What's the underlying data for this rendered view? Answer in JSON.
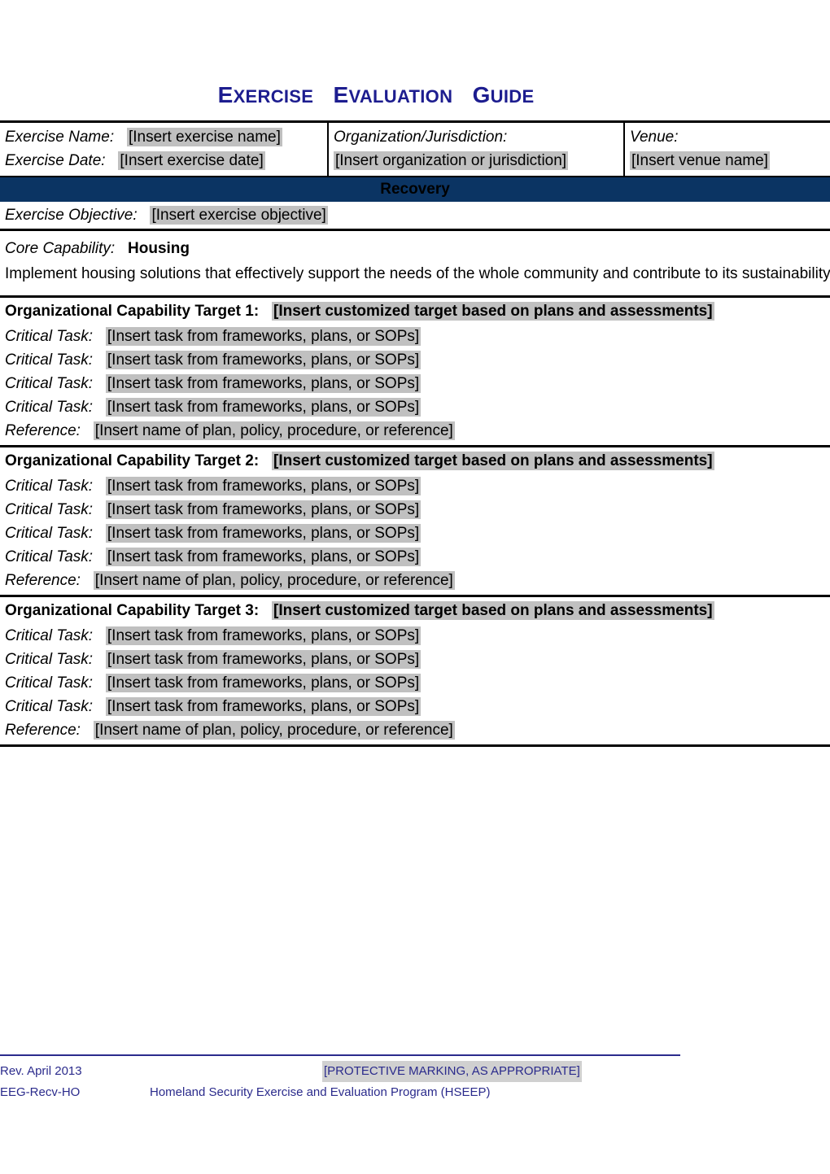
{
  "document": {
    "title_words": [
      {
        "cap": "E",
        "rest": "XERCISE"
      },
      {
        "cap": "E",
        "rest": "VALUATION"
      },
      {
        "cap": "G",
        "rest": "UIDE"
      }
    ],
    "title_plain": "Exercise Evaluation Guide"
  },
  "colors": {
    "title_blue": "#1d1d8f",
    "banner_navy": "#0b3463",
    "footer_blue": "#2b2b8c",
    "highlight_gray": "#c0c0c0"
  },
  "header": {
    "exercise_name_label": "Exercise Name:",
    "exercise_name_value": "[Insert exercise name]",
    "exercise_date_label": "Exercise Date:",
    "exercise_date_value": "[Insert exercise date]",
    "organization_label": "Organization/Jurisdiction:",
    "organization_value": "[Insert organization or jurisdiction]",
    "venue_label": "Venue:",
    "venue_value": "[Insert venue name]"
  },
  "mission_area": {
    "banner_label": "Recovery"
  },
  "objective": {
    "label": "Exercise Objective:",
    "value": "[Insert exercise objective]"
  },
  "capability": {
    "label": "Core Capability:",
    "name": "Housing",
    "description": "Implement housing solutions that effectively support the needs of the whole community and contribute to its sustainability and resilience."
  },
  "targets": [
    {
      "label": "Organizational Capability Target 1:",
      "value": "[Insert customized target based on plans and assessments]",
      "tasks": [
        {
          "label": "Critical Task:",
          "value": "[Insert task from frameworks, plans, or SOPs]"
        },
        {
          "label": "Critical Task:",
          "value": "[Insert task from frameworks, plans, or SOPs]"
        },
        {
          "label": "Critical Task:",
          "value": "[Insert task from frameworks, plans, or SOPs]"
        },
        {
          "label": "Critical Task:",
          "value": "[Insert task from frameworks, plans, or SOPs]"
        }
      ],
      "reference_label": "Reference:",
      "reference_value": "[Insert name of plan, policy, procedure, or reference]"
    },
    {
      "label": "Organizational Capability Target 2:",
      "value": "[Insert customized target based on plans and assessments]",
      "tasks": [
        {
          "label": "Critical Task:",
          "value": "[Insert task from frameworks, plans, or SOPs]"
        },
        {
          "label": "Critical Task:",
          "value": "[Insert task from frameworks, plans, or SOPs]"
        },
        {
          "label": "Critical Task:",
          "value": "[Insert task from frameworks, plans, or SOPs]"
        },
        {
          "label": "Critical Task:",
          "value": "[Insert task from frameworks, plans, or SOPs]"
        }
      ],
      "reference_label": "Reference:",
      "reference_value": "[Insert name of plan, policy, procedure, or reference]"
    },
    {
      "label": "Organizational Capability Target 3:",
      "value": "[Insert customized target based on plans and assessments]",
      "tasks": [
        {
          "label": "Critical Task:",
          "value": "[Insert task from frameworks, plans, or SOPs]"
        },
        {
          "label": "Critical Task:",
          "value": "[Insert task from frameworks, plans, or SOPs]"
        },
        {
          "label": "Critical Task:",
          "value": "[Insert task from frameworks, plans, or SOPs]"
        },
        {
          "label": "Critical Task:",
          "value": "[Insert task from frameworks, plans, or SOPs]"
        }
      ],
      "reference_label": "Reference:",
      "reference_value": "[Insert name of plan, policy, procedure, or reference]"
    }
  ],
  "footer": {
    "revision": "Rev. April 2013",
    "protective_marking": "[PROTECTIVE MARKING, AS APPROPRIATE]",
    "doc_code": "EEG-Recv-HO",
    "program": "Homeland Security Exercise and Evaluation Program (HSEEP)"
  }
}
